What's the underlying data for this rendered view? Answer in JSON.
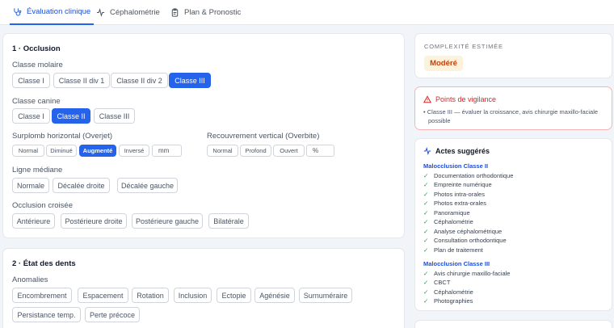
{
  "tabs": [
    {
      "label": "Évaluation clinique",
      "active": true
    },
    {
      "label": "Céphalométrie",
      "active": false
    },
    {
      "label": "Plan & Pronostic",
      "active": false
    }
  ],
  "occlusion": {
    "title": "1 · Occlusion",
    "molaire": {
      "label": "Classe molaire",
      "options": [
        "Classe I",
        "Classe II div 1",
        "Classe II div 2",
        "Classe III"
      ],
      "selected": "Classe III"
    },
    "canine": {
      "label": "Classe canine",
      "options": [
        "Classe I",
        "Classe II",
        "Classe III"
      ],
      "selected": "Classe II"
    },
    "overjet": {
      "label": "Surplomb horizontal (Overjet)",
      "options": [
        "Normal",
        "Diminué",
        "Augmenté",
        "Inversé"
      ],
      "selected": "Augmenté",
      "unit": "mm"
    },
    "overbite": {
      "label": "Recouvrement vertical (Overbite)",
      "options": [
        "Normal",
        "Profond",
        "Ouvert"
      ],
      "unit": "%"
    },
    "mediane": {
      "label": "Ligne médiane",
      "options": [
        "Normale",
        "Décalée droite",
        "Décalée gauche"
      ]
    },
    "croisee": {
      "label": "Occlusion croisée",
      "options": [
        "Antérieure",
        "Postérieure droite",
        "Postérieure gauche",
        "Bilatérale"
      ]
    }
  },
  "dents": {
    "title": "2 · État des dents",
    "anomalies": {
      "label": "Anomalies",
      "options": [
        "Encombrement",
        "Espacement",
        "Rotation",
        "Inclusion",
        "Ectopie",
        "Agénésie",
        "Surnuméraire",
        "Persistance temp.",
        "Perte précoce"
      ]
    }
  },
  "complexite": {
    "label": "COMPLEXITÉ ESTIMÉE",
    "value": "Modéré"
  },
  "vigilance": {
    "title": "Points de vigilance",
    "items": [
      "Classe III — évaluer la croissance, avis chirurgie maxillo-faciale",
      "possible"
    ]
  },
  "actes": {
    "title": "Actes suggérés",
    "groups": [
      {
        "name": "Malocclusion Classe II",
        "items": [
          "Documentation orthodontique",
          "Empreinte numérique",
          "Photos intra-orales",
          "Photos extra-orales",
          "Panoramique",
          "Céphalométrie",
          "Analyse céphalométrique",
          "Consultation orthodontique",
          "Plan de traitement"
        ]
      },
      {
        "name": "Malocclusion Classe III",
        "items": [
          "Avis chirurgie maxillo-faciale",
          "CBCT",
          "Céphalométrie",
          "Photographies"
        ]
      }
    ]
  },
  "colors": {
    "accent": "#2563eb",
    "warning": "#dc2626",
    "badge": "#c2410c",
    "check": "#16a34a"
  }
}
